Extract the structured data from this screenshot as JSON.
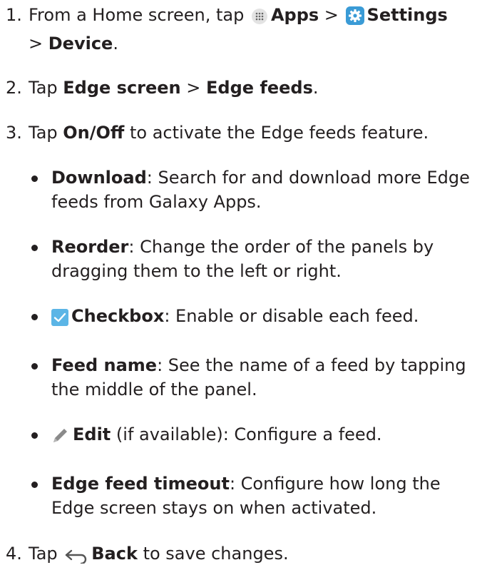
{
  "steps": [
    {
      "number": "1.",
      "pre": "From a Home screen, tap ",
      "apps_icon": "apps-grid-icon",
      "apps_label": "Apps",
      "sep1": " > ",
      "settings_icon": "settings-gear-icon",
      "settings_label": "Settings",
      "sep2": " > ",
      "device_label": "Device",
      "post": "."
    },
    {
      "number": "2.",
      "pre": "Tap ",
      "edge_screen_label": "Edge screen",
      "sep": " > ",
      "edge_feeds_label": "Edge feeds",
      "post": "."
    },
    {
      "number": "3.",
      "pre": "Tap ",
      "onoff_label": "On/Off",
      "post": " to activate the Edge feeds feature."
    },
    {
      "number": "4.",
      "pre": "Tap ",
      "back_icon": "back-arrow-icon",
      "back_label": "Back",
      "post": " to save changes."
    }
  ],
  "bullets": [
    {
      "label": "Download",
      "text": ": Search for and download more Edge feeds from Galaxy Apps."
    },
    {
      "label": "Reorder",
      "text": ": Change the order of the panels by dragging them to the left or right."
    },
    {
      "icon": "checkbox-checked-icon",
      "label": "Checkbox",
      "text": ": Enable or disable each feed."
    },
    {
      "label": "Feed name",
      "text": ": See the name of a feed by tapping the middle of the panel."
    },
    {
      "icon": "pencil-edit-icon",
      "label": "Edit",
      "text": " (if available): Configure a feed."
    },
    {
      "label": "Edge feed timeout",
      "text": ": Configure how long the Edge screen stays on when activated."
    }
  ],
  "colors": {
    "text": "#231f20",
    "settings_icon_bg": "#3a9bd6",
    "checkbox_bg": "#5bb5e6",
    "pencil": "#8a8a8a"
  }
}
